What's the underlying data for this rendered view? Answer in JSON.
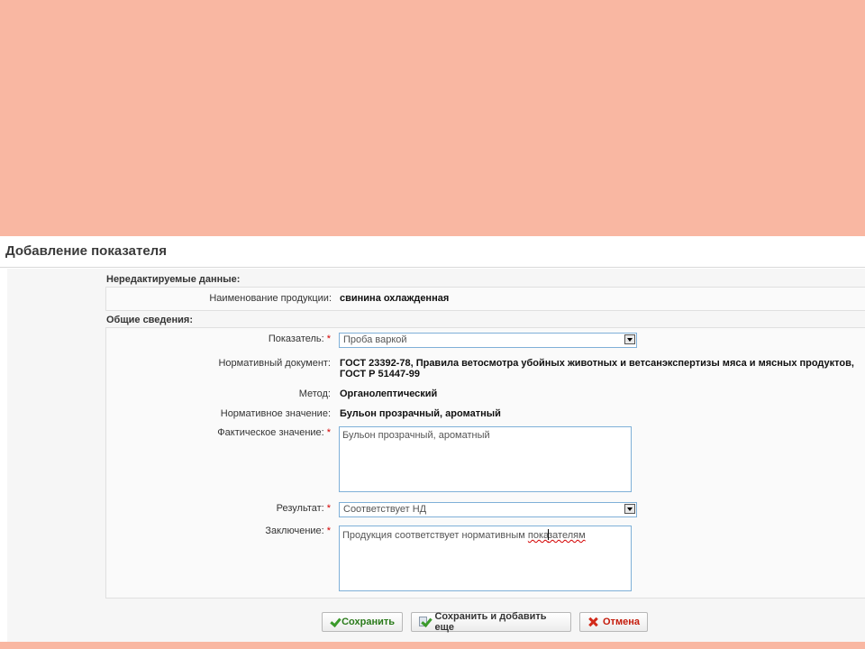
{
  "dialog": {
    "title": "Добавление показателя"
  },
  "readonly_section": {
    "label": "Нередактируемые данные:",
    "product_label": "Наименование продукции:",
    "product_value": "свинина охлажденная"
  },
  "general_section": {
    "label": "Общие сведения:",
    "indicator_label": "Показатель:",
    "indicator_value": "Проба варкой",
    "normdoc_label": "Нормативный документ:",
    "normdoc_value_line1": "ГОСТ 23392-78, Правила ветосмотра убойных животных и ветсанэкспертизы мяса и мясных продуктов,",
    "normdoc_value_line2": "ГОСТ Р 51447-99",
    "method_label": "Метод:",
    "method_value": "Органолептический",
    "normvalue_label": "Нормативное значение:",
    "normvalue_value": "Бульон прозрачный, ароматный",
    "actual_label": "Фактическое значение:",
    "actual_value": "Бульон прозрачный, ароматный",
    "result_label": "Результат:",
    "result_value": "Соответствует НД",
    "conclusion_label": "Заключение:",
    "conclusion_value_part1": "Продукция соответствует нормативным ",
    "conclusion_value_part2": "пока",
    "conclusion_value_part3": "зателям",
    "required_mark": "*"
  },
  "buttons": {
    "save": "Сохранить",
    "save_add": "Сохранить и добавить еще",
    "cancel": "Отмена"
  },
  "colors": {
    "background": "#f9b7a2",
    "input_border": "#7fb0d8",
    "required": "#d40000",
    "save_text": "#2a7a1a",
    "cancel_text": "#c41a0a"
  }
}
